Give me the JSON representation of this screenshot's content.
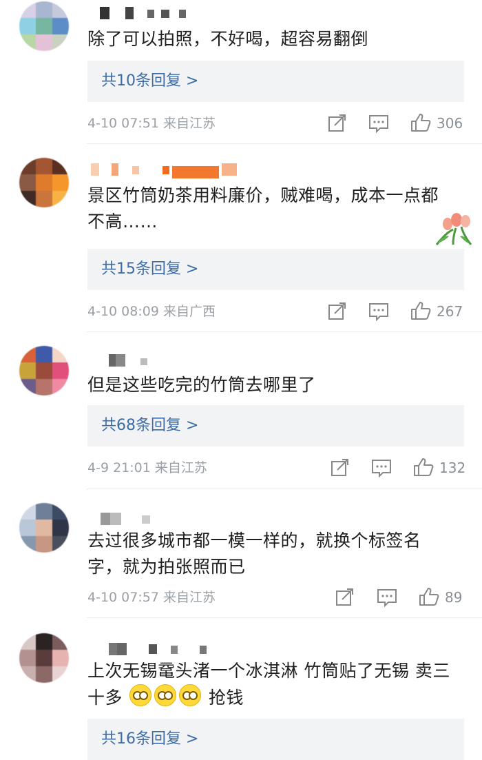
{
  "comments": [
    {
      "text": "除了可以拍照，不好喝，超容易翻倒",
      "reply_label": "共10条回复 >",
      "meta": "4-10 07:51 来自江苏",
      "likes": "306"
    },
    {
      "text": "景区竹筒奶茶用料廉价，贼难喝，成本一点都不高……",
      "reply_label": "共15条回复 >",
      "meta": "4-10 08:09 来自广西",
      "likes": "267"
    },
    {
      "text": "但是这些吃完的竹筒去哪里了",
      "reply_label": "共68条回复 >",
      "meta": "4-9 21:01 来自江苏",
      "likes": "132"
    },
    {
      "text": "去过很多城市都一模一样的，就换个标签名字，就为拍张照而已",
      "meta": "4-10 07:57 来自江苏",
      "likes": "89"
    },
    {
      "text_before": "上次无锡鼋头渚一个冰淇淋 竹筒贴了无锡 卖三十多",
      "text_after": "抢钱",
      "reply_label": "共16条回复 >"
    }
  ],
  "icons": {
    "share": "share-icon",
    "comment": "comment-icon",
    "like": "thumbs-up-icon",
    "sticker": "tulip-sticker-icon",
    "emoji": "smiling-face-with-glasses-emoji"
  },
  "colors": {
    "reply_link": "#3d6ca7",
    "reply_bg": "#f2f3f5",
    "meta": "#9aa0a6"
  }
}
